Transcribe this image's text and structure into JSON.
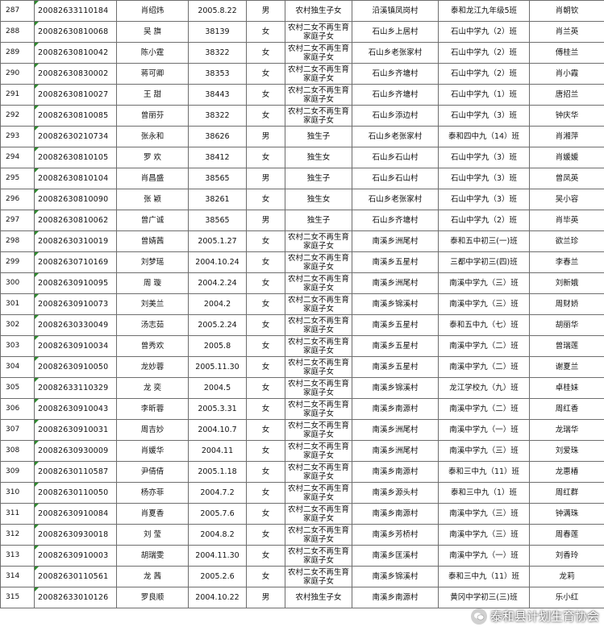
{
  "rows": [
    [
      "287",
      "20082633110184",
      "肖绍炜",
      "2005.8.22",
      "男",
      "农村独生子女",
      "沿溪镇凤岗村",
      "泰和龙江九年级5班",
      "肖朝钦"
    ],
    [
      "288",
      "20082630810068",
      "吴  旗",
      "38139",
      "女",
      "农村二女不再生育家庭子女",
      "石山乡上居村",
      "石山中学九（2）班",
      "肖兰英"
    ],
    [
      "289",
      "20082630810042",
      "陈小霆",
      "38322",
      "女",
      "农村二女不再生育家庭子女",
      "石山乡老张家村",
      "石山中学九（2）班",
      "傅桂兰"
    ],
    [
      "290",
      "20082630830002",
      "蒋可卿",
      "38353",
      "女",
      "农村二女不再生育家庭子女",
      "石山乡齐塘村",
      "石山中学九（2）班",
      "肖小霞"
    ],
    [
      "291",
      "20082630810027",
      "王  甜",
      "38443",
      "女",
      "农村二女不再生育家庭子女",
      "石山乡齐塘村",
      "石山中学九（1）班",
      "唐招兰"
    ],
    [
      "292",
      "20082630810085",
      "曾丽芬",
      "38322",
      "女",
      "农村二女不再生育家庭子女",
      "石山乡添边村",
      "石山中学九（3）班",
      "钟庆华"
    ],
    [
      "293",
      "20082630210734",
      "张永和",
      "38626",
      "男",
      "独生子",
      "石山乡老张家村",
      "泰和四中九（14）班",
      "肖湘萍"
    ],
    [
      "294",
      "20082630810105",
      "罗  欢",
      "38412",
      "女",
      "独生女",
      "石山乡石山村",
      "石山中学九（3）班",
      "肖媛媛"
    ],
    [
      "295",
      "20082630810104",
      "肖昌盛",
      "38565",
      "男",
      "独生子",
      "石山乡石山村",
      "石山中学九（3）班",
      "曾凤英"
    ],
    [
      "296",
      "20082630810090",
      "张  颖",
      "38261",
      "女",
      "独生女",
      "石山乡老张家村",
      "石山中学九（3）班",
      "吴小容"
    ],
    [
      "297",
      "20082630810062",
      "曾广诚",
      "38565",
      "男",
      "独生子",
      "石山乡齐塘村",
      "石山中学九（2）班",
      "肖毕英"
    ],
    [
      "298",
      "20082630310019",
      "曾婧茜",
      "2005.1.27",
      "女",
      "农村二女不再生育家庭子女",
      "南溪乡洲尾村",
      "泰和五中初三(一)班",
      "欲兰珍"
    ],
    [
      "299",
      "20082630710169",
      "刘梦瑶",
      "2004.10.24",
      "女",
      "农村二女不再生育家庭子女",
      "南溪乡五星村",
      "三都中学初三(四)班",
      "李春兰"
    ],
    [
      "300",
      "20082630910095",
      "周  璇",
      "2004.2.24",
      "女",
      "农村二女不再生育家庭子女",
      "南溪乡洲尾村",
      "南溪中学九（三）班",
      "刘新娥"
    ],
    [
      "301",
      "20082630910073",
      "刘美兰",
      "2004.2",
      "女",
      "农村二女不再生育家庭子女",
      "南溪乡锦溪村",
      "南溪中学九（三）班",
      "周财娇"
    ],
    [
      "302",
      "20082630330049",
      "汤志茹",
      "2005.2.24",
      "女",
      "农村二女不再生育家庭子女",
      "南溪乡五星村",
      "泰和五中九（七）班",
      "胡丽华"
    ],
    [
      "303",
      "20082630910034",
      "曾秀欢",
      "2005.8",
      "女",
      "农村二女不再生育家庭子女",
      "南溪乡五星村",
      "南溪中学九（二）班",
      "曾瑞莲"
    ],
    [
      "304",
      "20082630910050",
      "龙妙蓉",
      "2005.11.30",
      "女",
      "农村二女不再生育家庭子女",
      "南溪乡五星村",
      "南溪中学九（二）班",
      "谢夏兰"
    ],
    [
      "305",
      "20082633110329",
      "龙  奕",
      "2004.5",
      "女",
      "农村二女不再生育家庭子女",
      "南溪乡锦溪村",
      "龙江学校九（九）班",
      "卓桂妹"
    ],
    [
      "306",
      "20082630910043",
      "李昕蓉",
      "2005.3.31",
      "女",
      "农村二女不再生育家庭子女",
      "南溪乡南源村",
      "南溪中学九（二）班",
      "周红香"
    ],
    [
      "307",
      "20082630910031",
      "周吉妙",
      "2004.10.7",
      "女",
      "农村二女不再生育家庭子女",
      "南溪乡洲尾村",
      "南溪中学九（一）班",
      "龙瑞华"
    ],
    [
      "308",
      "20082630930009",
      "肖媛华",
      "2004.11",
      "女",
      "农村二女不再生育家庭子女",
      "南溪乡洲尾村",
      "南溪中学九（三）班",
      "刘爱珠"
    ],
    [
      "309",
      "20082630110587",
      "尹倩倩",
      "2005.1.18",
      "女",
      "农村二女不再生育家庭子女",
      "南溪乡南源村",
      "泰和三中九（11）班",
      "龙惠椿"
    ],
    [
      "310",
      "20082630110050",
      "杨亦菲",
      "2004.7.2",
      "女",
      "农村二女不再生育家庭子女",
      "南溪乡源头村",
      "泰和三中九（1）班",
      "周红群"
    ],
    [
      "311",
      "20082630910084",
      "肖夏香",
      "2005.7.6",
      "女",
      "农村二女不再生育家庭子女",
      "南溪乡南源村",
      "南溪中学九（三）班",
      "钟满珠"
    ],
    [
      "312",
      "20082630930018",
      "刘  莹",
      "2004.8.2",
      "女",
      "农村二女不再生育家庭子女",
      "南溪乡芳桥村",
      "南溪中学九（三）班",
      "周春莲"
    ],
    [
      "313",
      "20082630910003",
      "胡瑞雯",
      "2004.11.30",
      "女",
      "农村二女不再生育家庭子女",
      "南溪乡匡溪村",
      "南溪中学九（一）班",
      "刘香玲"
    ],
    [
      "314",
      "20082630110561",
      "龙  茜",
      "2005.2.6",
      "女",
      "农村二女不再生育家庭子女",
      "南溪乡锦溪村",
      "泰和三中九（11）班",
      "龙莉"
    ],
    [
      "315",
      "20082633010126",
      "罗良顺",
      "2004.10.22",
      "男",
      "农村独生子女",
      "南溪乡南源村",
      "黄冈中学初三(三)班",
      "乐小红"
    ]
  ],
  "watermark": {
    "text": "泰和县计划生育协会",
    "icon": "wechat-icon"
  }
}
